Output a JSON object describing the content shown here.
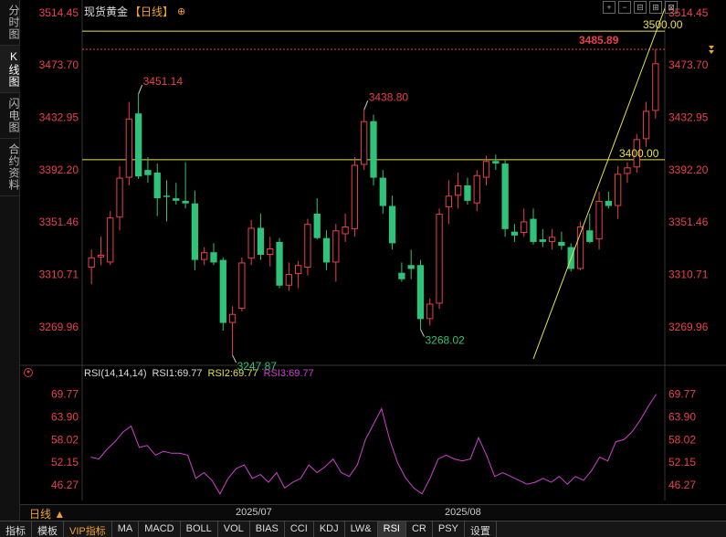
{
  "sidebar": {
    "tabs": [
      {
        "label": "分时图"
      },
      {
        "label": "K线图"
      },
      {
        "label": "闪电图"
      },
      {
        "label": "合约资料"
      }
    ]
  },
  "header": {
    "instrument": "现货黄金",
    "period_label": "【日线】",
    "settings_icon": "⊕"
  },
  "toolbar_icons": [
    "+",
    "−",
    "⊟",
    "⊞",
    "⊠"
  ],
  "price_chart": {
    "price_ticks": [
      "3514.45",
      "3473.70",
      "3432.95",
      "3392.20",
      "3351.46",
      "3310.71",
      "3269.96"
    ],
    "annotations": {
      "high_1": "3451.14",
      "high_2": "3438.80",
      "low_1": "3247.87",
      "low_2": "3268.02",
      "line_3500": "3500.00",
      "line_3400": "3400.00",
      "last_price": "3485.89"
    },
    "colors": {
      "up": "#e8404c",
      "down": "#2fc27a",
      "hline": "#e8e04a",
      "last": "#e8404c"
    }
  },
  "rsi": {
    "legend_params": "RSI(14,14,14)",
    "legend_rsi1": "RSI1:69.77",
    "legend_rsi2": "RSI2:69.77",
    "legend_rsi3": "RSI3:69.77",
    "ticks": [
      "69.77",
      "63.90",
      "58.02",
      "52.15",
      "46.27"
    ]
  },
  "period_bar": {
    "period": "日线 ▲",
    "dates": [
      "2025/07",
      "2025/08"
    ]
  },
  "indicator_tabs": [
    "指标",
    "模板",
    "VIP指标",
    "MA",
    "MACD",
    "BOLL",
    "VOL",
    "BIAS",
    "CCI",
    "KDJ",
    "LW&",
    "RSI",
    "CR",
    "PSY",
    "设置"
  ],
  "chart_data": {
    "type": "candlestick",
    "y_range": [
      3240,
      3520
    ],
    "candles": [
      {
        "o": 3316,
        "h": 3330,
        "l": 3303,
        "c": 3324
      },
      {
        "o": 3324,
        "h": 3340,
        "l": 3318,
        "c": 3326
      },
      {
        "o": 3320,
        "h": 3360,
        "l": 3318,
        "c": 3355
      },
      {
        "o": 3355,
        "h": 3395,
        "l": 3345,
        "c": 3386
      },
      {
        "o": 3386,
        "h": 3445,
        "l": 3380,
        "c": 3432
      },
      {
        "o": 3436,
        "h": 3451.14,
        "l": 3385,
        "c": 3387
      },
      {
        "o": 3392,
        "h": 3402,
        "l": 3382,
        "c": 3388
      },
      {
        "o": 3390,
        "h": 3397,
        "l": 3356,
        "c": 3370
      },
      {
        "o": 3372,
        "h": 3384,
        "l": 3352,
        "c": 3371
      },
      {
        "o": 3370,
        "h": 3382,
        "l": 3365,
        "c": 3368
      },
      {
        "o": 3368,
        "h": 3398,
        "l": 3362,
        "c": 3366
      },
      {
        "o": 3366,
        "h": 3376,
        "l": 3314,
        "c": 3322
      },
      {
        "o": 3322,
        "h": 3332,
        "l": 3318,
        "c": 3328
      },
      {
        "o": 3328,
        "h": 3335,
        "l": 3318,
        "c": 3320
      },
      {
        "o": 3322,
        "h": 3324,
        "l": 3267,
        "c": 3273
      },
      {
        "o": 3273,
        "h": 3286,
        "l": 3247.87,
        "c": 3280
      },
      {
        "o": 3284,
        "h": 3324,
        "l": 3282,
        "c": 3320
      },
      {
        "o": 3323,
        "h": 3353,
        "l": 3318,
        "c": 3347
      },
      {
        "o": 3347,
        "h": 3358,
        "l": 3322,
        "c": 3326
      },
      {
        "o": 3326,
        "h": 3340,
        "l": 3317,
        "c": 3331
      },
      {
        "o": 3336,
        "h": 3339,
        "l": 3300,
        "c": 3302
      },
      {
        "o": 3302,
        "h": 3320,
        "l": 3298,
        "c": 3311
      },
      {
        "o": 3311,
        "h": 3321,
        "l": 3300,
        "c": 3318
      },
      {
        "o": 3316,
        "h": 3354,
        "l": 3310,
        "c": 3350
      },
      {
        "o": 3358,
        "h": 3370,
        "l": 3338,
        "c": 3339
      },
      {
        "o": 3339,
        "h": 3345,
        "l": 3314,
        "c": 3320
      },
      {
        "o": 3320,
        "h": 3350,
        "l": 3305,
        "c": 3345
      },
      {
        "o": 3342,
        "h": 3358,
        "l": 3336,
        "c": 3348
      },
      {
        "o": 3346,
        "h": 3402,
        "l": 3340,
        "c": 3396
      },
      {
        "o": 3396,
        "h": 3438.8,
        "l": 3392,
        "c": 3430
      },
      {
        "o": 3430,
        "h": 3435,
        "l": 3380,
        "c": 3386
      },
      {
        "o": 3386,
        "h": 3392,
        "l": 3358,
        "c": 3364
      },
      {
        "o": 3364,
        "h": 3372,
        "l": 3330,
        "c": 3335
      },
      {
        "o": 3312,
        "h": 3320,
        "l": 3305,
        "c": 3307
      },
      {
        "o": 3318,
        "h": 3330,
        "l": 3307,
        "c": 3315
      },
      {
        "o": 3318,
        "h": 3322,
        "l": 3268.02,
        "c": 3276
      },
      {
        "o": 3276,
        "h": 3292,
        "l": 3271,
        "c": 3288
      },
      {
        "o": 3288,
        "h": 3362,
        "l": 3284,
        "c": 3358
      },
      {
        "o": 3363,
        "h": 3384,
        "l": 3350,
        "c": 3372
      },
      {
        "o": 3372,
        "h": 3390,
        "l": 3362,
        "c": 3380
      },
      {
        "o": 3380,
        "h": 3386,
        "l": 3365,
        "c": 3368
      },
      {
        "o": 3366,
        "h": 3392,
        "l": 3360,
        "c": 3388
      },
      {
        "o": 3386,
        "h": 3403,
        "l": 3380,
        "c": 3399
      },
      {
        "o": 3399,
        "h": 3404,
        "l": 3392,
        "c": 3397
      },
      {
        "o": 3397,
        "h": 3400,
        "l": 3340,
        "c": 3346
      },
      {
        "o": 3344,
        "h": 3350,
        "l": 3336,
        "c": 3341
      },
      {
        "o": 3343,
        "h": 3362,
        "l": 3340,
        "c": 3352
      },
      {
        "o": 3354,
        "h": 3362,
        "l": 3334,
        "c": 3336
      },
      {
        "o": 3338,
        "h": 3346,
        "l": 3332,
        "c": 3336
      },
      {
        "o": 3336,
        "h": 3346,
        "l": 3330,
        "c": 3340
      },
      {
        "o": 3336,
        "h": 3344,
        "l": 3330,
        "c": 3333
      },
      {
        "o": 3332,
        "h": 3335,
        "l": 3313,
        "c": 3315
      },
      {
        "o": 3315,
        "h": 3352,
        "l": 3314,
        "c": 3348
      },
      {
        "o": 3345,
        "h": 3358,
        "l": 3335,
        "c": 3336
      },
      {
        "o": 3338,
        "h": 3375,
        "l": 3330,
        "c": 3368
      },
      {
        "o": 3368,
        "h": 3375,
        "l": 3362,
        "c": 3364
      },
      {
        "o": 3364,
        "h": 3395,
        "l": 3354,
        "c": 3389
      },
      {
        "o": 3389,
        "h": 3398,
        "l": 3382,
        "c": 3394
      },
      {
        "o": 3394,
        "h": 3420,
        "l": 3390,
        "c": 3416
      },
      {
        "o": 3416,
        "h": 3445,
        "l": 3410,
        "c": 3438
      },
      {
        "o": 3438,
        "h": 3485.89,
        "l": 3432,
        "c": 3475
      }
    ],
    "horizontal_lines": [
      3500.0,
      3400.0
    ],
    "last_price": 3485.89,
    "trendline": [
      {
        "i": 47,
        "p": 3245
      },
      {
        "i": 61,
        "p": 3518
      }
    ],
    "rsi_range": [
      43.0,
      72.5
    ],
    "rsi_values": [
      53.5,
      53.0,
      55.5,
      57.5,
      60.0,
      61.5,
      56.0,
      56.5,
      54.0,
      55.0,
      54.5,
      54.5,
      54.0,
      48.0,
      49.5,
      47.5,
      44.0,
      48.0,
      50.5,
      51.5,
      48.0,
      49.0,
      47.0,
      49.5,
      45.5,
      47.0,
      48.0,
      51.5,
      49.5,
      51.0,
      53.0,
      49.5,
      48.5,
      51.5,
      58.0,
      62.0,
      66.0,
      58.0,
      52.0,
      48.0,
      45.5,
      44.0,
      48.0,
      53.0,
      54.0,
      53.0,
      52.5,
      53.0,
      58.5,
      54.0,
      48.5,
      49.5,
      48.5,
      47.5,
      46.5,
      47.0,
      48.0,
      47.0,
      48.5,
      46.5,
      48.5,
      47.5,
      50.0,
      53.5,
      52.5,
      57.5,
      58.0,
      60.0,
      63.0,
      66.5,
      69.77
    ]
  }
}
